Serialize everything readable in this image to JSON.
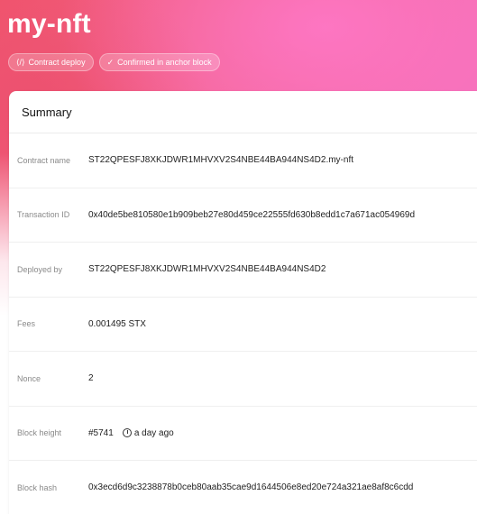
{
  "header": {
    "title": "my-nft",
    "badges": [
      {
        "icon": "code-icon",
        "label": "Contract deploy"
      },
      {
        "icon": "check-icon",
        "label": "Confirmed in anchor block"
      }
    ]
  },
  "summary": {
    "heading": "Summary",
    "rows": [
      {
        "label": "Contract name",
        "value": "ST22QPESFJ8XKJDWR1MHVXV2S4NBE44BA944NS4D2.my-nft"
      },
      {
        "label": "Transaction ID",
        "value": "0x40de5be810580e1b909beb27e80d459ce22555fd630b8edd1c7a671ac054969d"
      },
      {
        "label": "Deployed by",
        "value": "ST22QPESFJ8XKJDWR1MHVXV2S4NBE44BA944NS4D2"
      },
      {
        "label": "Fees",
        "value": "0.001495 STX"
      },
      {
        "label": "Nonce",
        "value": "2"
      },
      {
        "label": "Block height",
        "value": "#5741",
        "time": "a day ago"
      },
      {
        "label": "Block hash",
        "value": "0x3ecd6d9c3238878b0ceb80aab35cae9d1644506e8ed20e724a321ae8af8c6cdd"
      }
    ]
  },
  "colors": {
    "hero_start": "#f1556d",
    "hero_end": "#f77fd0",
    "label_text": "#8a8a8a",
    "value_text": "#222222"
  }
}
